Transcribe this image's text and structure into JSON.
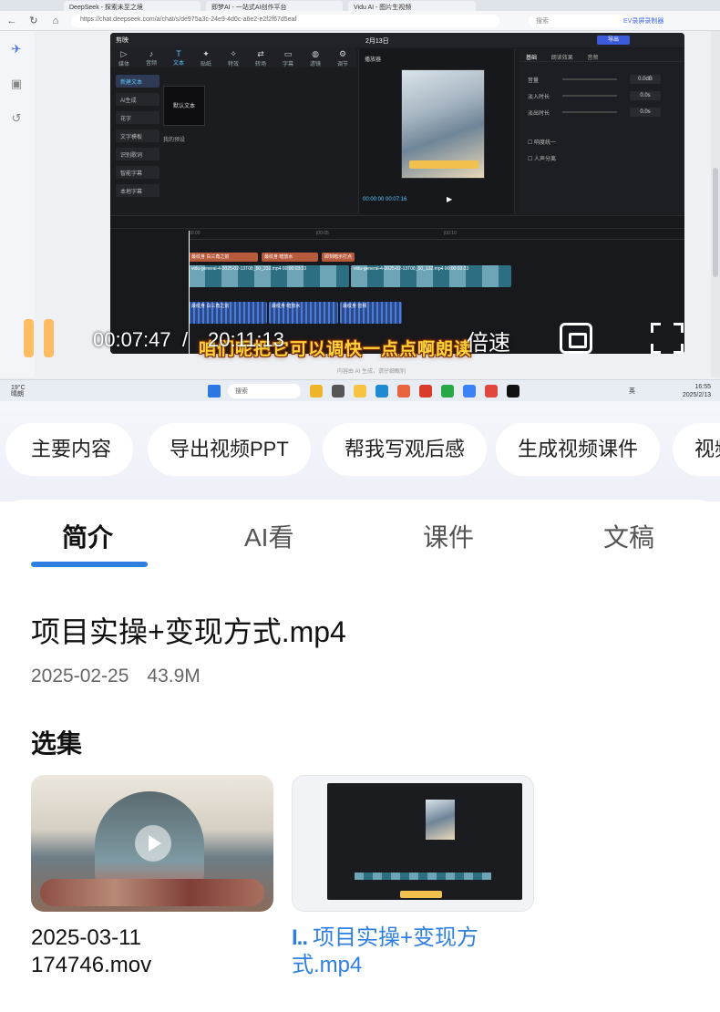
{
  "video": {
    "browser": {
      "tabs": [
        "DeepSeek - 探索未至之境",
        "即梦AI - 一站式AI创作平台",
        "Vidu AI - 图片生视频"
      ],
      "url": "https://chat.deepseek.com/a/chat/s/de975a3c-24e9-4d0c-a6e2-e2f2f67d5eaf",
      "search_placeholder": "搜索",
      "extension_label": "EV录屏录制器"
    },
    "editor": {
      "app_name": "剪映",
      "project_title": "2月13日",
      "export_label": "导出",
      "tools": [
        {
          "icon": "▷",
          "label": "媒体"
        },
        {
          "icon": "♪",
          "label": "音频"
        },
        {
          "icon": "T",
          "label": "文本"
        },
        {
          "icon": "✦",
          "label": "贴纸"
        },
        {
          "icon": "✧",
          "label": "特效"
        },
        {
          "icon": "⇄",
          "label": "转场"
        },
        {
          "icon": "▭",
          "label": "字幕"
        },
        {
          "icon": "◍",
          "label": "滤镜"
        },
        {
          "icon": "⚙",
          "label": "调节"
        }
      ],
      "side_items": [
        "新建文本",
        "AI生成",
        "花字",
        "文字模板",
        "识别歌词",
        "智能字幕",
        "本地字幕"
      ],
      "preset_label": "默认文本",
      "preset_section": "我的预设",
      "player_label": "播放器",
      "player_time": "00:00:00  00:07:16",
      "props_tabs": [
        "基础",
        "朗读效果",
        "音频"
      ],
      "props_rows": [
        {
          "label": "音量",
          "value": "0.0dB"
        },
        {
          "label": "淡入时长",
          "value": "0.0s"
        },
        {
          "label": "淡出时长",
          "value": "0.0s"
        }
      ],
      "props_checks": [
        "响度统一",
        "人声分离"
      ],
      "ruler_ticks": [
        "00:00",
        "|00:05",
        "|00:10"
      ],
      "clips": {
        "text": [
          "最纹身 白三角之前",
          "最纹身 暗放水",
          "即刻暗示打点"
        ],
        "video": [
          "vidu-general-4-2025-02-13T08_50_232.mp4  00:00:03:23",
          "vidu-general-4-2025-02-13T08_50_132.mp4  00:00:03:23"
        ],
        "audio": [
          "最纹身 白三角之前",
          "最纹身 暗放水",
          "最纹身 音频"
        ]
      }
    },
    "subtitle": "咱们呢把它可以调快一点点啊朗读",
    "footnote": "内容由 AI 生成，请仔细甄别",
    "controls": {
      "current_time": "00:07:47",
      "separator": "/",
      "total_time": "20:11:13",
      "speed_label": "倍速"
    },
    "taskbar": {
      "weather_temp": "19°C",
      "weather_desc": "晴朗",
      "search_label": "搜索",
      "ime": "英",
      "time": "16:55",
      "date": "2025/2/13"
    }
  },
  "chips": [
    "主要内容",
    "导出视频PPT",
    "帮我写观后感",
    "生成视频课件",
    "视频"
  ],
  "tabs": [
    {
      "label": "简介",
      "active": true
    },
    {
      "label": "AI看",
      "active": false
    },
    {
      "label": "课件",
      "active": false
    },
    {
      "label": "文稿",
      "active": false
    }
  ],
  "file": {
    "title": "项目实操+变现方式.mp4",
    "date": "2025-02-25",
    "size": "43.9M"
  },
  "episodes_label": "选集",
  "episodes": [
    {
      "title": "2025-03-11\n174746.mov",
      "playing": false
    },
    {
      "playing_mark": "I..",
      "title": "项目实操+变现方式.mp4",
      "playing": true
    }
  ],
  "colors": {
    "accent": "#2f7fe0",
    "subtitle": "#ffd43b"
  }
}
